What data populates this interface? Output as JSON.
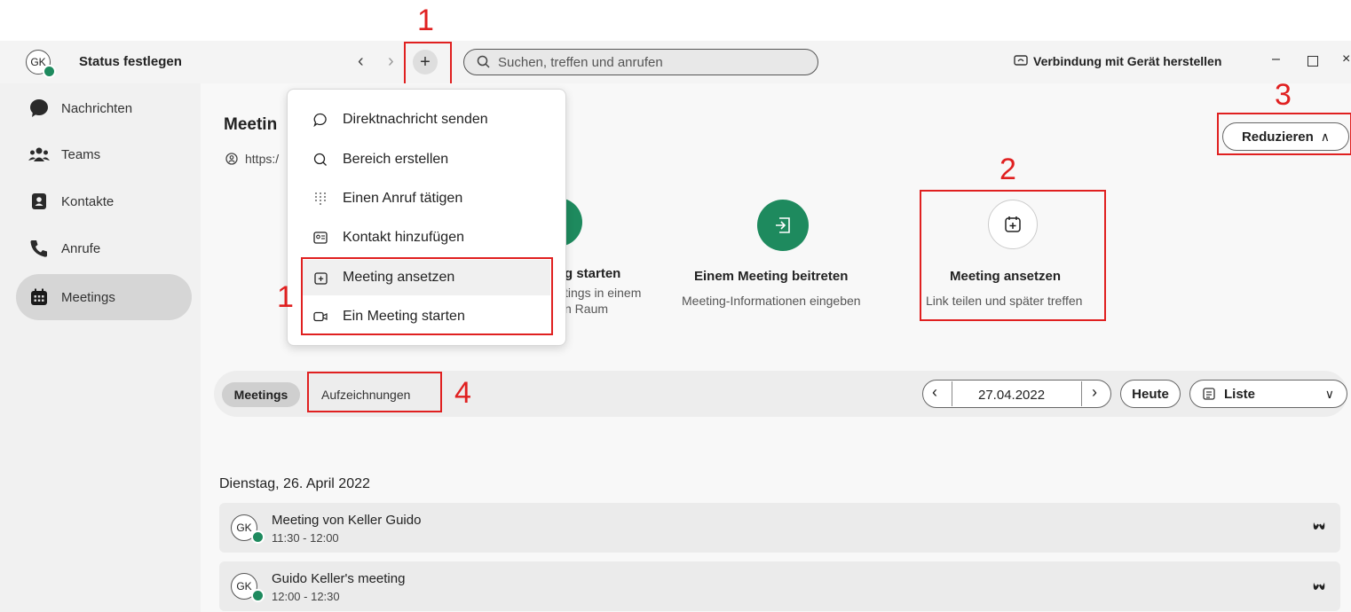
{
  "topbar": {
    "avatar_initials": "GK",
    "status_label": "Status festlegen",
    "search_placeholder": "Suchen, treffen und anrufen",
    "connect_label": "Verbindung mit Gerät herstellen"
  },
  "sidebar": {
    "items": [
      {
        "label": "Nachrichten",
        "icon": "chat-bubble-icon"
      },
      {
        "label": "Teams",
        "icon": "people-icon"
      },
      {
        "label": "Kontakte",
        "icon": "contacts-icon"
      },
      {
        "label": "Anrufe",
        "icon": "phone-icon"
      },
      {
        "label": "Meetings",
        "icon": "calendar-icon",
        "active": true
      }
    ]
  },
  "main": {
    "title_partial": "Meetin",
    "link_partial": "https:/",
    "collapse_label": "Reduzieren",
    "cards": [
      {
        "title_partial": "g starten",
        "desc1_partial": "tings in einem",
        "desc2_partial": "n Raum"
      },
      {
        "title": "Einem Meeting beitreten",
        "desc": "Meeting-Informationen eingeben"
      },
      {
        "title": "Meeting ansetzen",
        "desc": "Link teilen und später treffen"
      }
    ],
    "tabs": [
      "Meetings",
      "Aufzeichnungen"
    ],
    "date": "27.04.2022",
    "today_label": "Heute",
    "view_label": "Liste",
    "day_heading": "Dienstag, 26. April 2022",
    "meetings": [
      {
        "initials": "GK",
        "title": "Meeting von Keller Guido",
        "time": "11:30 - 12:00"
      },
      {
        "initials": "GK",
        "title": "Guido Keller's meeting",
        "time": "12:00 - 12:30"
      }
    ]
  },
  "plus_menu": {
    "items": [
      {
        "label": "Direktnachricht senden",
        "icon": "chat-icon"
      },
      {
        "label": "Bereich erstellen",
        "icon": "space-icon"
      },
      {
        "label": "Einen Anruf tätigen",
        "icon": "dialpad-icon"
      },
      {
        "label": "Kontakt hinzufügen",
        "icon": "contact-card-icon"
      },
      {
        "label": "Meeting ansetzen",
        "icon": "calendar-add-icon"
      },
      {
        "label": "Ein Meeting starten",
        "icon": "video-icon"
      }
    ]
  },
  "annotations": [
    "1",
    "1",
    "2",
    "3",
    "4"
  ],
  "colors": {
    "accent_green": "#1e8a5e",
    "annotation_red": "#e02020"
  }
}
